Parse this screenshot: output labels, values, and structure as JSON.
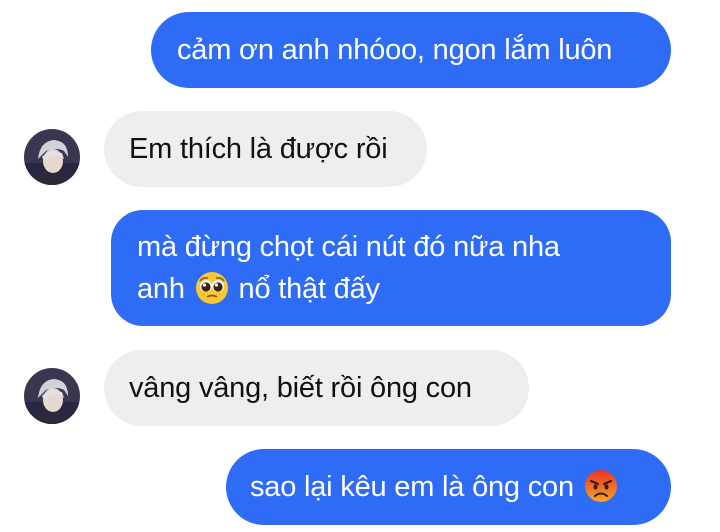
{
  "conversation": {
    "messages": [
      {
        "side": "sent",
        "text": "cảm ơn anh nhóoo, ngon lắm luôn"
      },
      {
        "side": "received",
        "text": "Em thích là được rồi"
      },
      {
        "side": "sent",
        "line1": "mà đừng chọt cái nút đó nữa nha",
        "line2_pre": "anh",
        "line2_emoji": "pleading-face-emoji",
        "line2_post": "nổ thật đấy"
      },
      {
        "side": "received",
        "text": "vâng vâng, biết rồi ông con"
      },
      {
        "side": "sent",
        "text": "sao lại kêu em là ông con",
        "emoji": "angry-face-emoji"
      }
    ]
  },
  "colors": {
    "sent_bubble": "#2e6cf6",
    "received_bubble": "#eeeeef",
    "sent_text": "#ffffff",
    "received_text": "#111111"
  }
}
